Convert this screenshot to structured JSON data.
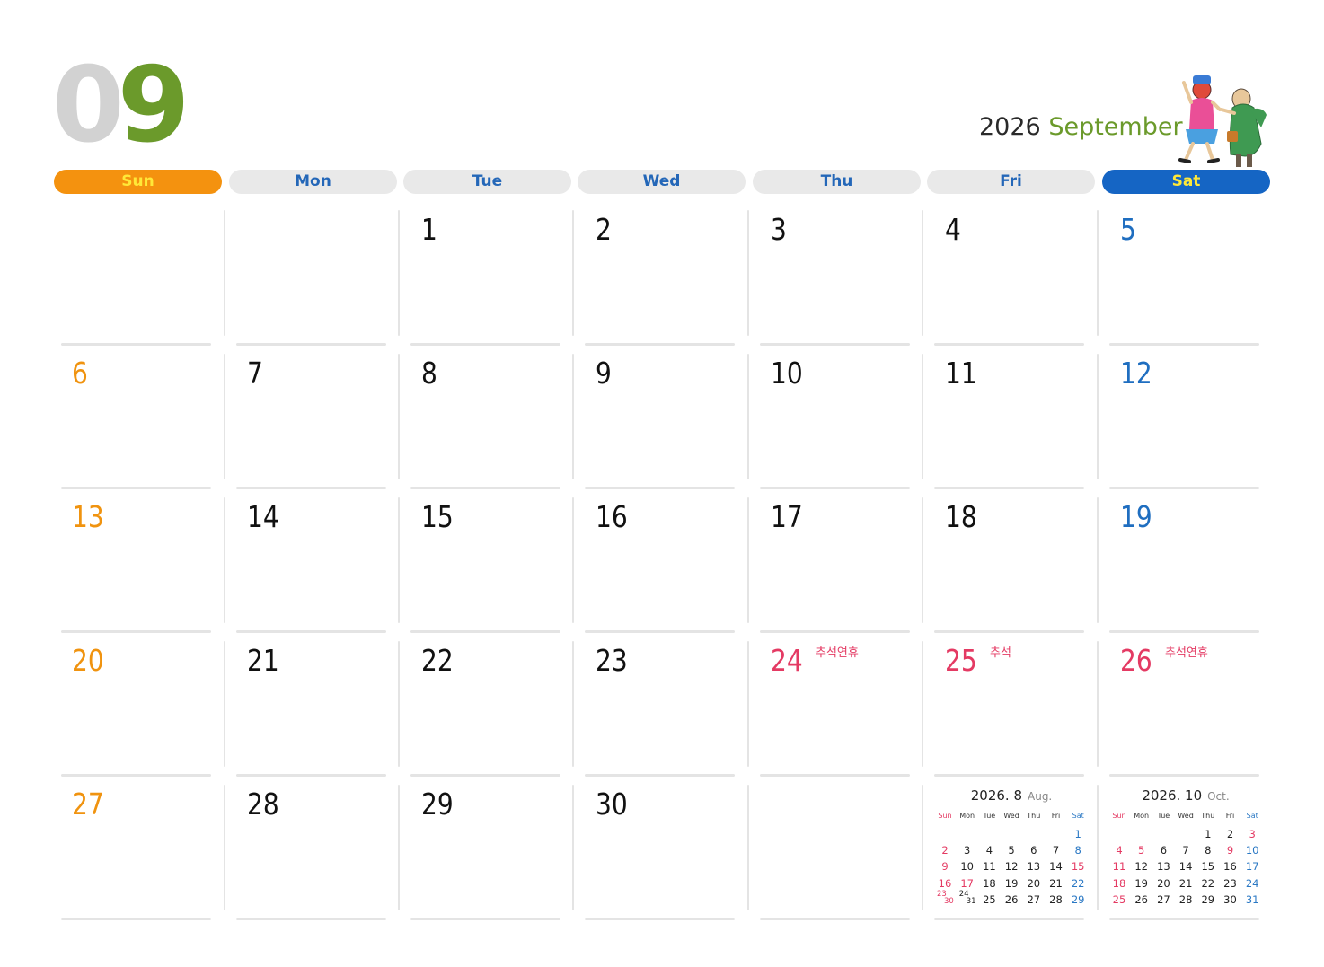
{
  "header": {
    "month_number_first": "0",
    "month_number_second": "9",
    "year": "2026",
    "month_name": "September"
  },
  "weekdays": [
    "Sun",
    "Mon",
    "Tue",
    "Wed",
    "Thu",
    "Fri",
    "Sat"
  ],
  "colors": {
    "sunday": "#f0930f",
    "saturday": "#1f6ec0",
    "holiday": "#e43a63",
    "accent_green": "#6b9a2b",
    "weekday_header": "#2467b8"
  },
  "weeks": [
    [
      {
        "d": ""
      },
      {
        "d": ""
      },
      {
        "d": "1"
      },
      {
        "d": "2"
      },
      {
        "d": "3"
      },
      {
        "d": "4"
      },
      {
        "d": "5"
      }
    ],
    [
      {
        "d": "6"
      },
      {
        "d": "7"
      },
      {
        "d": "8"
      },
      {
        "d": "9"
      },
      {
        "d": "10"
      },
      {
        "d": "11"
      },
      {
        "d": "12"
      }
    ],
    [
      {
        "d": "13"
      },
      {
        "d": "14"
      },
      {
        "d": "15"
      },
      {
        "d": "16"
      },
      {
        "d": "17"
      },
      {
        "d": "18"
      },
      {
        "d": "19"
      }
    ],
    [
      {
        "d": "20"
      },
      {
        "d": "21"
      },
      {
        "d": "22"
      },
      {
        "d": "23"
      },
      {
        "d": "24",
        "holiday": true,
        "label": "추석연휴"
      },
      {
        "d": "25",
        "holiday": true,
        "label": "추석"
      },
      {
        "d": "26",
        "holiday": true,
        "label": "추석연휴"
      }
    ],
    [
      {
        "d": "27"
      },
      {
        "d": "28"
      },
      {
        "d": "29"
      },
      {
        "d": "30"
      },
      {
        "d": ""
      },
      {
        "d": ""
      },
      {
        "d": ""
      }
    ]
  ],
  "mini_calendars": [
    {
      "title": "2026. 8",
      "abbr": "Aug.",
      "weekdays": [
        "Sun",
        "Mon",
        "Tue",
        "Wed",
        "Thu",
        "Fri",
        "Sat"
      ],
      "rows": [
        [
          "",
          "",
          "",
          "",
          "",
          "",
          "1"
        ],
        [
          "2",
          "3",
          "4",
          "5",
          "6",
          "7",
          "8"
        ],
        [
          "9",
          "10",
          "11",
          "12",
          "13",
          "14",
          "15"
        ],
        [
          "16",
          "17",
          "18",
          "19",
          "20",
          "21",
          "22"
        ],
        [
          "23/30",
          "24/31",
          "25",
          "26",
          "27",
          "28",
          "29"
        ]
      ],
      "holidays": [
        "15",
        "17"
      ]
    },
    {
      "title": "2026. 10",
      "abbr": "Oct.",
      "weekdays": [
        "Sun",
        "Mon",
        "Tue",
        "Wed",
        "Thu",
        "Fri",
        "Sat"
      ],
      "rows": [
        [
          "",
          "",
          "",
          "",
          "1",
          "2",
          "3"
        ],
        [
          "4",
          "5",
          "6",
          "7",
          "8",
          "9",
          "10"
        ],
        [
          "11",
          "12",
          "13",
          "14",
          "15",
          "16",
          "17"
        ],
        [
          "18",
          "19",
          "20",
          "21",
          "22",
          "23",
          "24"
        ],
        [
          "25",
          "26",
          "27",
          "28",
          "29",
          "30",
          "31"
        ]
      ],
      "holidays": [
        "3",
        "5",
        "9"
      ]
    }
  ]
}
